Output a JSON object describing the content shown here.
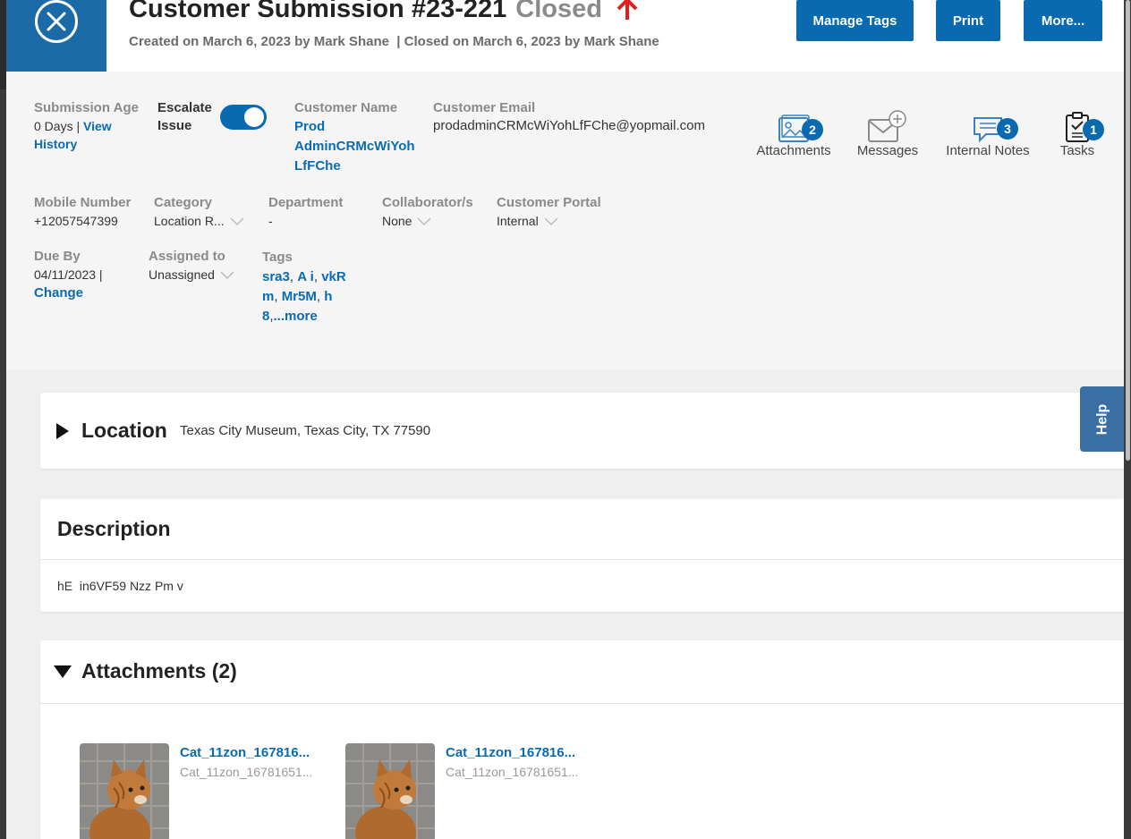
{
  "header": {
    "title": "Customer Submission #23-221",
    "status": "Closed",
    "created": "Created on March 6, 2023 by Mark Shane",
    "closed": "| Closed on March 6, 2023 by Mark Shane",
    "buttons": {
      "manage_tags": "Manage Tags",
      "print": "Print",
      "more": "More..."
    }
  },
  "info": {
    "submission_age": {
      "label": "Submission Age",
      "value": "0 Days |",
      "link": "View History"
    },
    "escalate": {
      "label_1": "Escalate",
      "label_2": "Issue",
      "on": true
    },
    "customer_name": {
      "label": "Customer Name",
      "value_1": "Prod",
      "value_2": "AdminCRMcWiYoh",
      "value_3": "LfFChe"
    },
    "customer_email": {
      "label": "Customer Email",
      "value": "prodadminCRMcWiYohLfFChe@yopmail.com"
    },
    "mobile": {
      "label": "Mobile Number",
      "value": "+12057547399"
    },
    "category": {
      "label": "Category",
      "value": "Location R..."
    },
    "department": {
      "label": "Department",
      "value": "-"
    },
    "collaborators": {
      "label": "Collaborator/s",
      "value": "None"
    },
    "portal": {
      "label": "Customer Portal",
      "value": "Internal"
    },
    "due_by": {
      "label": "Due By",
      "value": "04/11/2023 |",
      "link": "Change"
    },
    "assigned": {
      "label": "Assigned to",
      "value": "Unassigned"
    },
    "tags": {
      "label": "Tags",
      "t1": "sra3",
      "t2": "A i",
      "t3a": "vkR",
      "t3b": "m",
      "t4": "Mr5M",
      "t5a": "h",
      "t5b": "8",
      "more": "...more"
    }
  },
  "quick_actions": {
    "attachments": {
      "label": "Attachments",
      "count": "2"
    },
    "messages": {
      "label": "Messages"
    },
    "internal_notes": {
      "label": "Internal Notes",
      "count": "3"
    },
    "tasks": {
      "label": "Tasks",
      "count": "1"
    }
  },
  "location": {
    "title": "Location",
    "value": "Texas City Museum, Texas City, TX 77590"
  },
  "description": {
    "title": "Description",
    "text": "hE  in6VF59 Nzz Pm v"
  },
  "attachments": {
    "title": "Attachments (2)",
    "items": [
      {
        "name": "Cat_11zon_167816...",
        "sub": "Cat_11zon_16781651..."
      },
      {
        "name": "Cat_11zon_167816...",
        "sub": "Cat_11zon_16781651..."
      }
    ]
  },
  "help": {
    "label": "Help"
  },
  "colors": {
    "primary": "#0a6ab0",
    "header_block": "#1b6aa8",
    "status_closed": "#8a8a8a",
    "arrow": "#e02020"
  }
}
